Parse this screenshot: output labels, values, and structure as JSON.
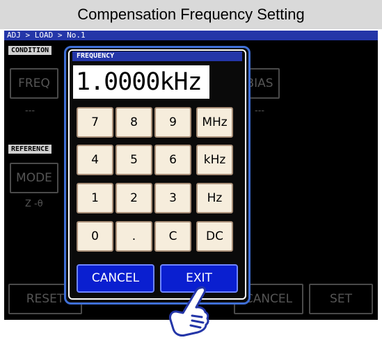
{
  "title": "Compensation Frequency Setting",
  "breadcrumb": "ADJ > LOAD > No.1",
  "background": {
    "condition_label": "CONDITION",
    "freq_label": "FREQ",
    "freq_value": "---",
    "bias_label": "BIAS",
    "bias_value": "---",
    "reference_label": "REFERENCE",
    "mode_label": "MODE",
    "mode_value": "Z -θ",
    "reset_label": "RESET",
    "cancel_label": "CANCEL",
    "set_label": "SET"
  },
  "dialog": {
    "header": "FREQUENCY",
    "value": "1.0000kHz",
    "keys": [
      [
        "7",
        "8",
        "9",
        "MHz"
      ],
      [
        "4",
        "5",
        "6",
        "kHz"
      ],
      [
        "1",
        "2",
        "3",
        "Hz"
      ],
      [
        "0",
        ".",
        "C",
        "DC"
      ]
    ],
    "cancel_label": "CANCEL",
    "exit_label": "EXIT"
  },
  "colors": {
    "header_blue": "#2436a8",
    "dialog_border": "#3f6fd6",
    "action_button": "#0a1fd0",
    "key_fill": "#f6eddc"
  },
  "icons": {
    "pointer": "pointing-hand-icon"
  }
}
